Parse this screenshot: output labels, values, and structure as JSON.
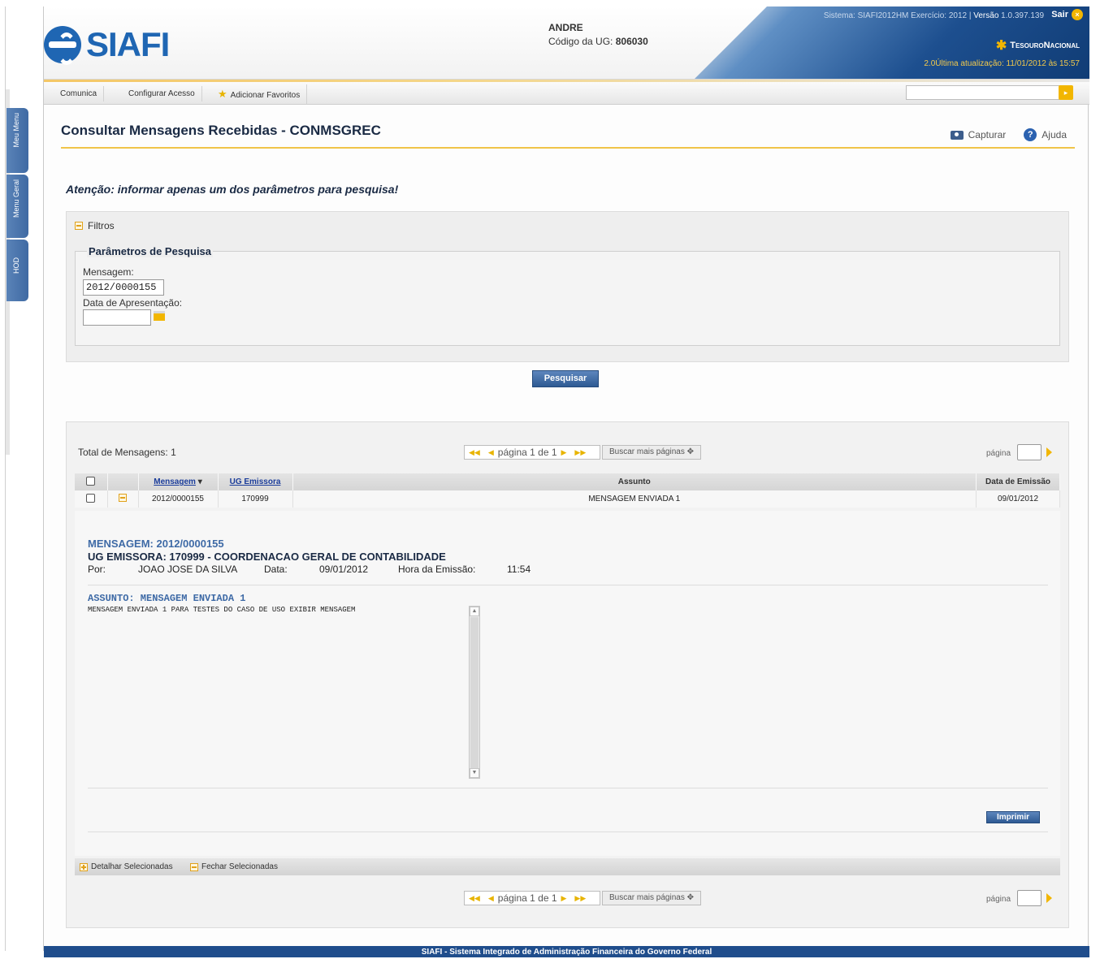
{
  "header": {
    "logo_text": "SIAFI",
    "user_name": "ANDRE",
    "ug_label": "Código da UG:",
    "ug_code": "806030",
    "system_info": "Sistema: SIAFI2012HM Exercício: 2012",
    "version_label": "Versão",
    "version": "1.0.397.139",
    "logout": "Sair",
    "brand": "TesouroNacional",
    "last_update": "2.0Última atualização: 11/01/2012 às 15:57"
  },
  "nav": {
    "items": [
      "Comunica",
      "Configurar Acesso",
      "Adicionar Favoritos"
    ],
    "search_value": ""
  },
  "side_tabs": [
    "Meu Menu",
    "Menu Geral",
    "HOD"
  ],
  "page": {
    "title": "Consultar Mensagens Recebidas - CONMSGREC",
    "capture": "Capturar",
    "help": "Ajuda",
    "warning": "Atenção: informar apenas um dos parâmetros para pesquisa!"
  },
  "filters": {
    "header": "Filtros",
    "legend": "Parâmetros de Pesquisa",
    "message_label": "Mensagem:",
    "message_value": "2012/0000155",
    "date_label": "Data de Apresentação:",
    "date_value": "",
    "search_button": "Pesquisar"
  },
  "results": {
    "total": "Total de Mensagens: 1",
    "pager_text": "página 1 de 1",
    "more_pages": "Buscar mais páginas",
    "page_label": "página",
    "columns": [
      "Mensagem",
      "UG Emissora",
      "Assunto",
      "Data de Emissão"
    ],
    "rows": [
      {
        "mensagem": "2012/0000155",
        "ug": "170999",
        "assunto": "MENSAGEM ENVIADA 1",
        "data": "09/01/2012"
      }
    ],
    "detail": {
      "message": "MENSAGEM: 2012/0000155",
      "ug": "UG EMISSORA: 170999 - COORDENACAO GERAL DE CONTABILIDADE",
      "por_label": "Por:",
      "por_value": "JOAO JOSE DA SILVA",
      "data_label": "Data:",
      "data_value": "09/01/2012",
      "hora_label": "Hora da Emissão:",
      "hora_value": "11:54",
      "assunto": "ASSUNTO: MENSAGEM ENVIADA 1",
      "body": "MENSAGEM ENVIADA 1 PARA TESTES DO CASO DE USO EXIBIR MENSAGEM",
      "print_button": "Imprimir"
    },
    "bulk_expand": "Detalhar Selecionadas",
    "bulk_close": "Fechar Selecionadas"
  },
  "footer": "SIAFI - Sistema Integrado de Administração Financeira do Governo Federal",
  "colors": {
    "brand_blue": "#1f66b3",
    "accent_yellow": "#f2b600",
    "title_navy": "#1a2a44"
  }
}
